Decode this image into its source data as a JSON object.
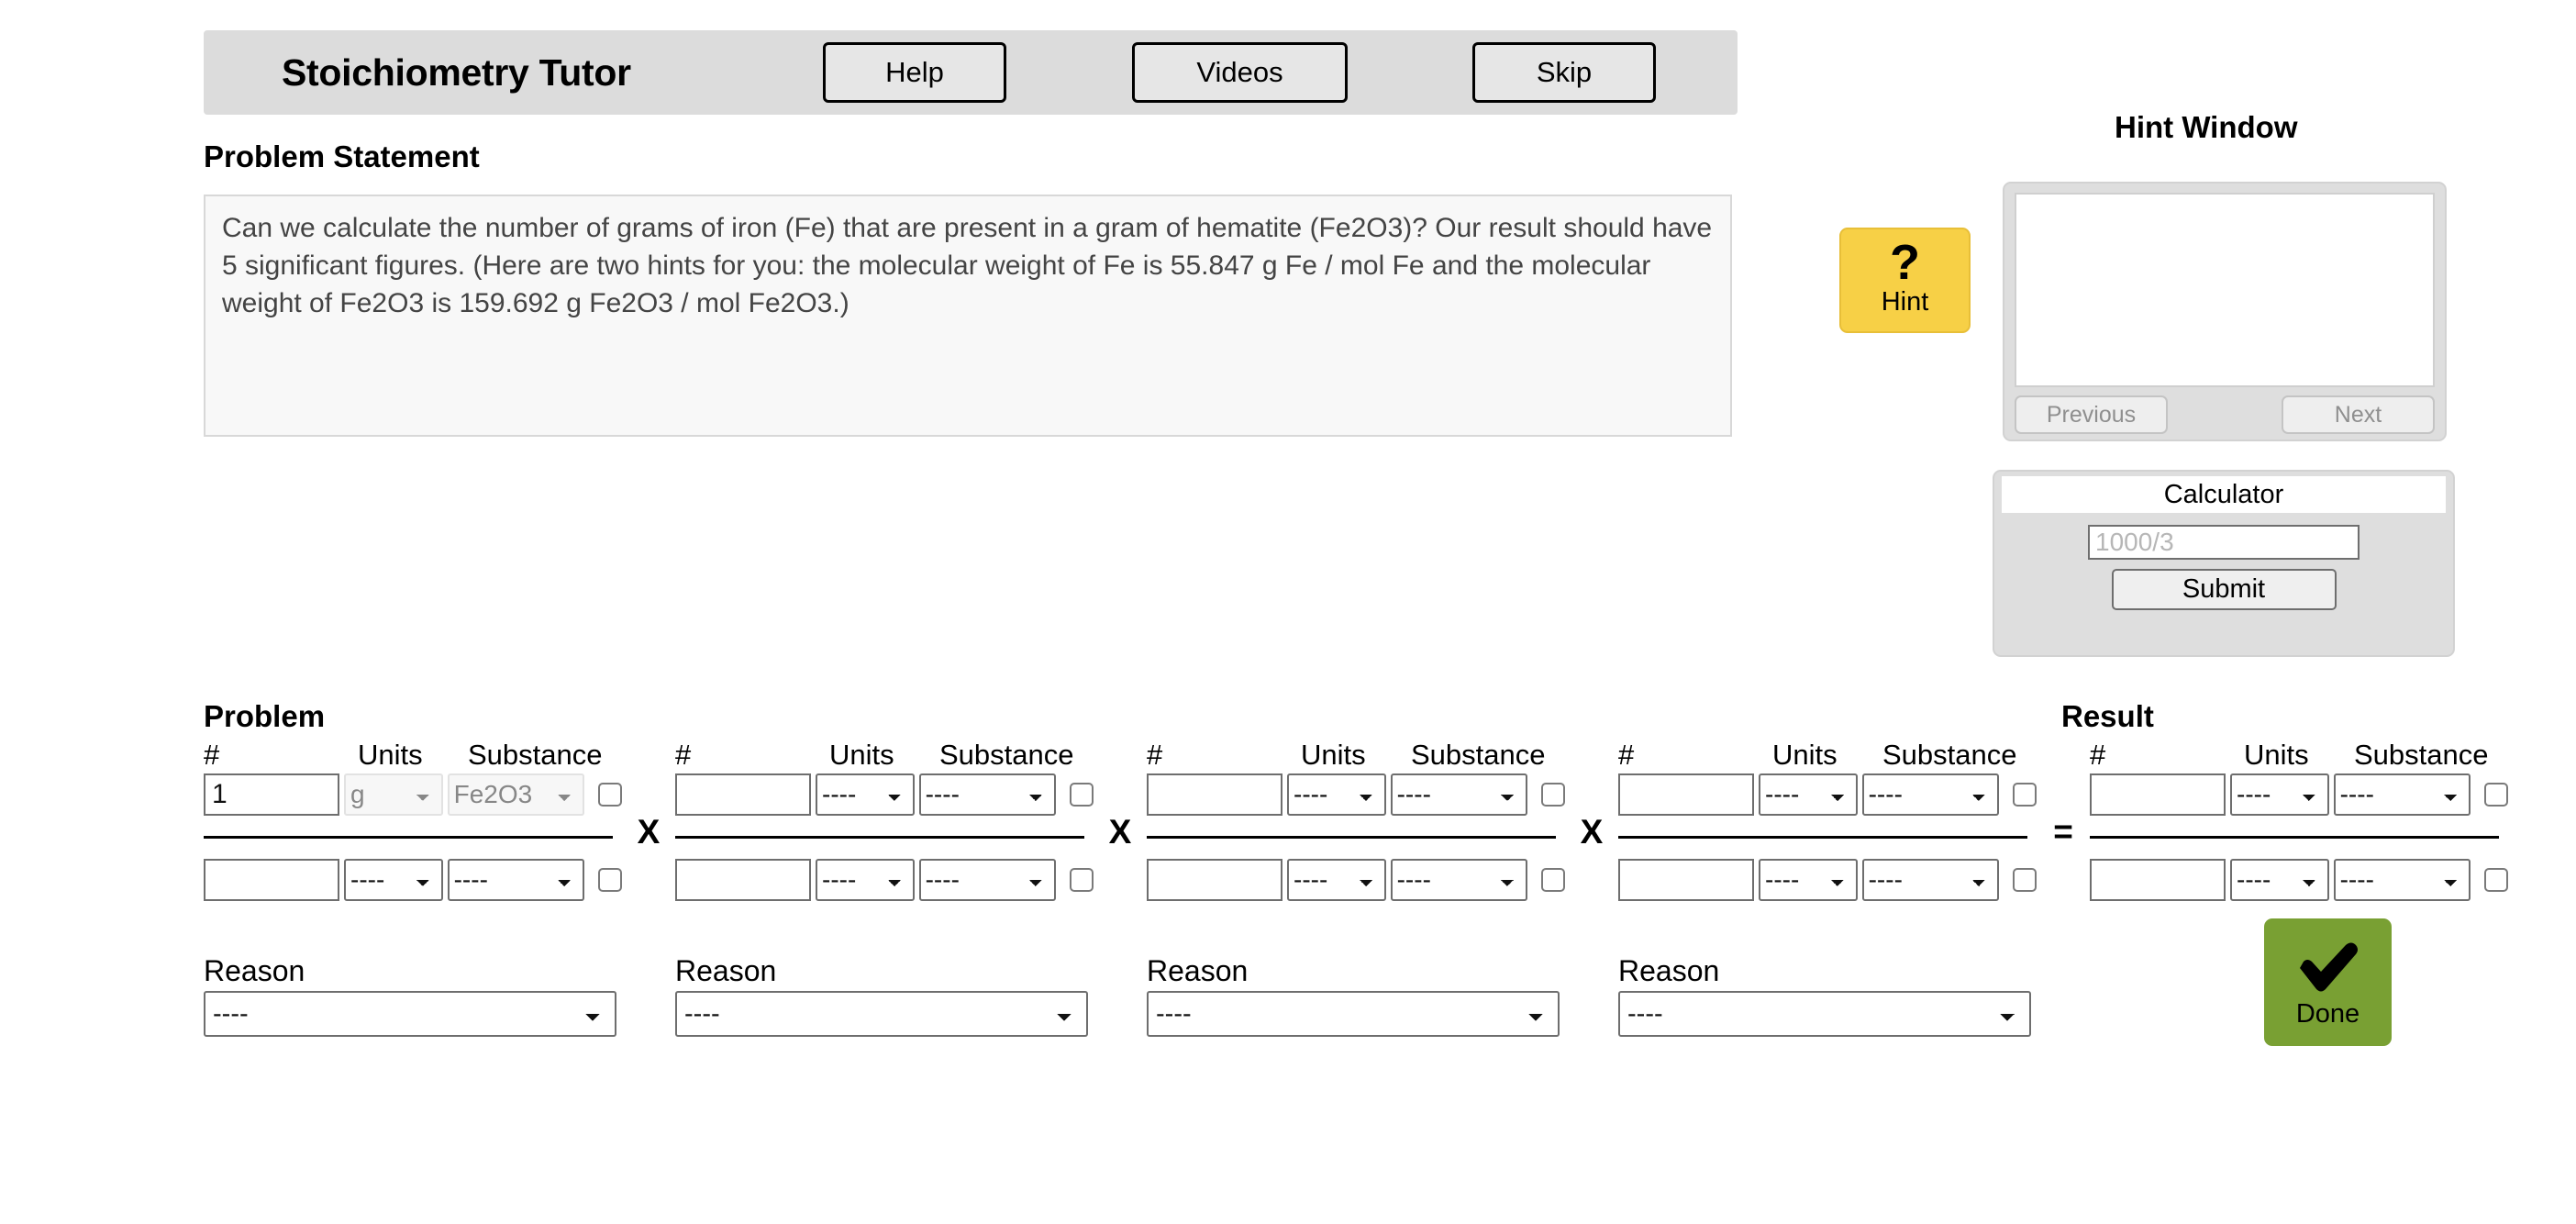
{
  "header": {
    "title": "Stoichiometry Tutor",
    "buttons": [
      {
        "label": "Help"
      },
      {
        "label": "Videos"
      },
      {
        "label": "Skip"
      }
    ]
  },
  "problem_statement": {
    "label": "Problem Statement",
    "text": "Can we calculate the number of grams of iron (Fe) that are present in a gram of hematite (Fe2O3)? Our result should have 5 significant figures. (Here are two hints for you: the molecular weight of Fe is 55.847 g Fe / mol Fe and the molecular weight of Fe2O3 is 159.692 g Fe2O3 / mol Fe2O3.)"
  },
  "hint": {
    "window_title": "Hint Window",
    "button_glyph": "?",
    "button_label": "Hint",
    "content": "",
    "previous_label": "Previous",
    "next_label": "Next"
  },
  "calculator": {
    "title": "Calculator",
    "input_value": "",
    "input_placeholder": "1000/3",
    "submit_label": "Submit"
  },
  "equation": {
    "problem_label": "Problem",
    "result_label": "Result",
    "column_headers": {
      "number": "#",
      "units": "Units",
      "substance": "Substance"
    },
    "placeholder_option": "----",
    "operators": [
      "X",
      "X",
      "X",
      "="
    ],
    "terms": [
      {
        "name": "term-1",
        "numerator": {
          "number": "1",
          "units": "g",
          "substance": "Fe2O3",
          "disabled": true,
          "checkbox_checked": false
        },
        "denominator": {
          "number": "",
          "units": "----",
          "substance": "----",
          "disabled": false,
          "checkbox_checked": false
        }
      },
      {
        "name": "term-2",
        "numerator": {
          "number": "",
          "units": "----",
          "substance": "----",
          "disabled": false,
          "checkbox_checked": false
        },
        "denominator": {
          "number": "",
          "units": "----",
          "substance": "----",
          "disabled": false,
          "checkbox_checked": false
        }
      },
      {
        "name": "term-3",
        "numerator": {
          "number": "",
          "units": "----",
          "substance": "----",
          "disabled": false,
          "checkbox_checked": false
        },
        "denominator": {
          "number": "",
          "units": "----",
          "substance": "----",
          "disabled": false,
          "checkbox_checked": false
        }
      },
      {
        "name": "term-4",
        "numerator": {
          "number": "",
          "units": "----",
          "substance": "----",
          "disabled": false,
          "checkbox_checked": false
        },
        "denominator": {
          "number": "",
          "units": "----",
          "substance": "----",
          "disabled": false,
          "checkbox_checked": false
        }
      },
      {
        "name": "result-term",
        "numerator": {
          "number": "",
          "units": "----",
          "substance": "----",
          "disabled": false,
          "checkbox_checked": false
        },
        "denominator": {
          "number": "",
          "units": "----",
          "substance": "----",
          "disabled": false,
          "checkbox_checked": false
        }
      }
    ]
  },
  "reasons": [
    {
      "label": "Reason",
      "value": "----"
    },
    {
      "label": "Reason",
      "value": "----"
    },
    {
      "label": "Reason",
      "value": "----"
    },
    {
      "label": "Reason",
      "value": "----"
    }
  ],
  "done": {
    "label": "Done",
    "icon": "check-icon"
  },
  "colors": {
    "hint_yellow": "#f7d046",
    "done_green": "#79a033",
    "header_gray": "#dcdcdc",
    "panel_gray": "#dedede"
  }
}
